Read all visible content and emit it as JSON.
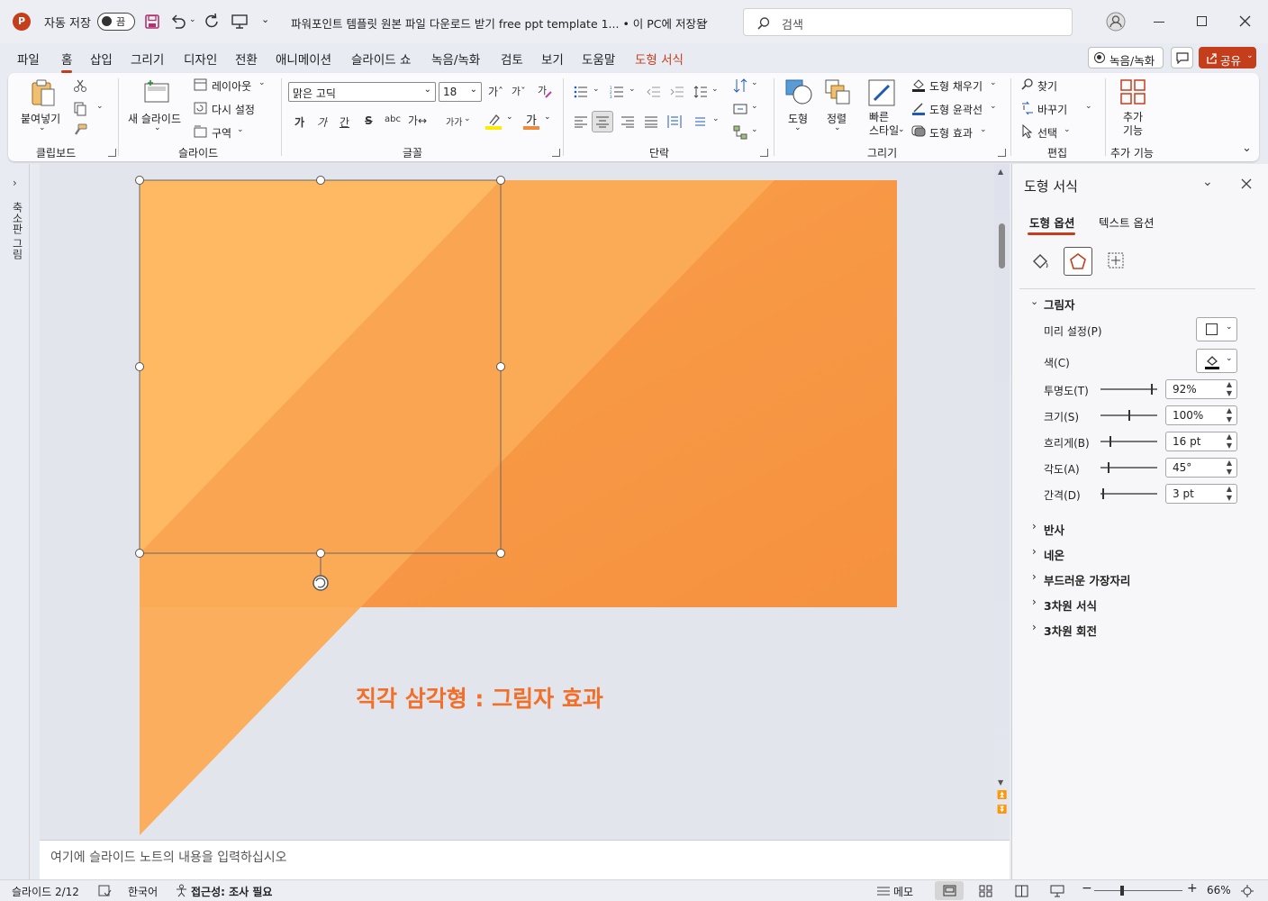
{
  "titlebar": {
    "autosave_label": "자동 저장",
    "autosave_state": "끔",
    "doc_title": "파워포인트 템플릿 원본 파일 다운로드 받기 free ppt template 1... • 이 PC에 저장됨",
    "search_placeholder": "검색"
  },
  "tabs": [
    {
      "label": "파일"
    },
    {
      "label": "홈"
    },
    {
      "label": "삽입"
    },
    {
      "label": "그리기"
    },
    {
      "label": "디자인"
    },
    {
      "label": "전환"
    },
    {
      "label": "애니메이션"
    },
    {
      "label": "슬라이드 쇼"
    },
    {
      "label": "녹음/녹화"
    },
    {
      "label": "검토"
    },
    {
      "label": "보기"
    },
    {
      "label": "도움말"
    },
    {
      "label": "도형 서식"
    }
  ],
  "header_buttons": {
    "record": "녹음/녹화",
    "share": "공유"
  },
  "ribbon": {
    "clipboard": {
      "paste": "붙여넣기",
      "group": "클립보드"
    },
    "slides": {
      "new_slide": "새 슬라이드",
      "layout": "레이아웃",
      "reset": "다시 설정",
      "section": "구역",
      "group": "슬라이드"
    },
    "font": {
      "name": "맑은 고딕",
      "size": "18",
      "group": "글꼴",
      "bold": "가",
      "italic": "가",
      "underline": "간",
      "strike": "S",
      "spacing": "가↔",
      "case": "가가",
      "highlight": "가",
      "color": "가",
      "grow": "가ˆ",
      "shrink": "가ˇ"
    },
    "paragraph": {
      "group": "단락"
    },
    "drawing": {
      "shapes": "도형",
      "arrange": "정렬",
      "quick_styles": "빠른\n스타일",
      "fill": "도형 채우기",
      "outline": "도형 윤곽선",
      "effects": "도형 효과",
      "group": "그리기"
    },
    "editing": {
      "find": "찾기",
      "replace": "바꾸기",
      "select": "선택",
      "group": "편집"
    },
    "addins": {
      "label": "추가\n기능",
      "group": "추가 기능"
    }
  },
  "rail": {
    "label": "축소판 그림"
  },
  "slide": {
    "caption": "직각 삼각형 : 그림자 효과"
  },
  "notes": {
    "placeholder": "여기에 슬라이드 노트의 내용을 입력하십시오"
  },
  "pane": {
    "title": "도형 서식",
    "tab_shape": "도형 옵션",
    "tab_text": "텍스트 옵션",
    "shadow_section": "그림자",
    "preset_label": "미리 설정(P)",
    "color_label": "색(C)",
    "props": [
      {
        "label": "투명도(T)",
        "value": "92%",
        "level": 0.92
      },
      {
        "label": "크기(S)",
        "value": "100%",
        "level": 0.5
      },
      {
        "label": "흐리게(B)",
        "value": "16 pt",
        "level": 0.16
      },
      {
        "label": "각도(A)",
        "value": "45°",
        "level": 0.125
      },
      {
        "label": "간격(D)",
        "value": "3 pt",
        "level": 0.03
      }
    ],
    "sections": [
      {
        "label": "반사"
      },
      {
        "label": "네온"
      },
      {
        "label": "부드러운 가장자리"
      },
      {
        "label": "3차원 서식"
      },
      {
        "label": "3차원 회전"
      }
    ]
  },
  "status": {
    "slide_counter": "슬라이드 2/12",
    "language": "한국어",
    "accessibility": "접근성: 조사 필요",
    "notes": "메모",
    "zoom": "66%"
  },
  "colors": {
    "accent": "#c43e1c",
    "shape_light": "#ffb65e",
    "shape_dark": "#f78b3a",
    "caption": "#f26f2a"
  }
}
